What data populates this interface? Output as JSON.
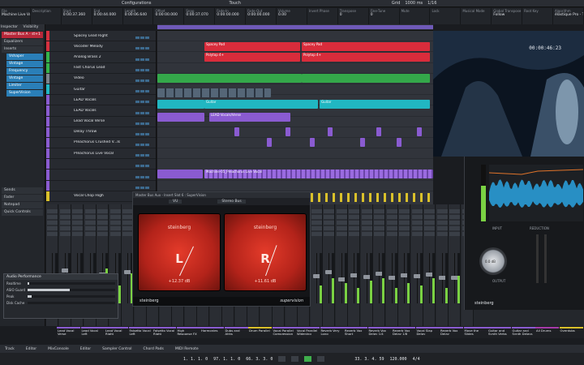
{
  "topbar": {
    "configurations": "Configurations",
    "automation_mode": "Touch",
    "grid": "Grid",
    "grid_value": "1000 ms",
    "quantize": "1/16"
  },
  "infobar": {
    "columns": [
      {
        "h": "File",
        "v": "Machine Live Vocal"
      },
      {
        "h": "Description",
        "v": ""
      },
      {
        "h": "Start",
        "v": "0:00:37.360"
      },
      {
        "h": "End",
        "v": "0:00:44.000"
      },
      {
        "h": "Length",
        "v": "0:00:06.640"
      },
      {
        "h": "Offset",
        "v": "0:00:00.000"
      },
      {
        "h": "Snap",
        "v": "0:00:37.070"
      },
      {
        "h": "Fade-In",
        "v": "0:00:00.000"
      },
      {
        "h": "Fade-Out",
        "v": "0:00:00.000"
      },
      {
        "h": "Volume",
        "v": "0.00"
      },
      {
        "h": "Invert Phase",
        "v": ""
      },
      {
        "h": "Transpose",
        "v": "0"
      },
      {
        "h": "Fine-Tune",
        "v": "0"
      },
      {
        "h": "Mute",
        "v": ""
      },
      {
        "h": "Lock",
        "v": ""
      },
      {
        "h": "Musical Mode",
        "v": ""
      },
      {
        "h": "Global Transpose",
        "v": "Follow"
      },
      {
        "h": "Root Key",
        "v": ""
      },
      {
        "h": "Algorithm",
        "v": "élastique Pro - Time"
      }
    ]
  },
  "inspector": {
    "tabs": [
      "Inspector",
      "Visibility"
    ],
    "selected_track": "Master Bus A - st+1",
    "sections": [
      "Equalizers",
      "Inserts"
    ],
    "inserts": [
      "Vshaper",
      "Vintage",
      "Frequency",
      "Vintage",
      "Limiter",
      "SuperVision"
    ],
    "lower_sections": [
      "Sends",
      "Fader",
      "Notepad",
      "Quick Controls"
    ]
  },
  "tracks": [
    {
      "name": "Spacey Lead Right",
      "color": "#d6303f"
    },
    {
      "name": "Vocoder Melody",
      "color": "#d6303f"
    },
    {
      "name": "Analog Brass 2",
      "color": "#34b34a"
    },
    {
      "name": "Fast Chorus Lead",
      "color": "#34b34a"
    },
    {
      "name": "Video",
      "color": "#7c838c"
    },
    {
      "name": "Guitar",
      "color": "#20b6c2"
    },
    {
      "name": "LEAD Vocals",
      "color": "#8a5bd1"
    },
    {
      "name": "LEAD Vocals",
      "color": "#8a5bd1"
    },
    {
      "name": "Lead Vocal Verse",
      "color": "#8a5bd1"
    },
    {
      "name": "Delay Throw",
      "color": "#8a5bd1"
    },
    {
      "name": "Preachorus Crushed V...Is",
      "color": "#8a5bd1"
    },
    {
      "name": "Preachorus Live Vocal",
      "color": "#8a5bd1"
    },
    {
      "name": "",
      "color": "#8a5bd1"
    },
    {
      "name": "",
      "color": "#8a5bd1"
    },
    {
      "name": "",
      "color": "#8a5bd1"
    },
    {
      "name": "Vocal Chop High",
      "color": "#d9c02a"
    }
  ],
  "events": {
    "spacey_a": "Spacey Pad",
    "spacey_b": "Spacey Pad",
    "poly_a": "Polytop 4+",
    "poly_b": "Polytop 4+",
    "guitar_a": "Guitar",
    "guitar_b": "Guitar",
    "lead_verse": "LEAD Vocals/Verse",
    "preachorus": "Machine-05_Preachorus Live Vocal"
  },
  "video": {
    "timecode": "00:00:46:23"
  },
  "supervision": {
    "window_title": "Master Bus Aux - Insert Slot 6 : SuperVision",
    "module": "VU",
    "channel": "Stereo Bus",
    "brand": "steinberg",
    "left": {
      "label": "L",
      "value": "+12.37 dB",
      "level": 0.78
    },
    "right": {
      "label": "R",
      "value": "+11.61 dB",
      "level": 0.72
    },
    "footer_brand": "steinberg",
    "product": "supervision"
  },
  "right_plugin": {
    "input_label": "INPUT",
    "reduction_label": "REDUCTION",
    "output_label": "OUTPUT",
    "knob_value": "0.0 dB",
    "brand": "steinberg"
  },
  "audio_performance": {
    "title": "Audio Performance",
    "rows": [
      {
        "label": "Realtime",
        "level": 0.02
      },
      {
        "label": "ASIO Guard",
        "level": 0.48
      },
      {
        "label": "Peak",
        "level": 0.05
      },
      {
        "label": "Disk Cache",
        "level": 0.0
      }
    ]
  },
  "mixer_names": [
    {
      "name": "Lead Vocal Verse",
      "color": "#8a5bd1"
    },
    {
      "name": "Lead Vocal Left",
      "color": "#8a5bd1"
    },
    {
      "name": "Lead Vocal Right",
      "color": "#8a5bd1"
    },
    {
      "name": "Falsetto Vocal Left",
      "color": "#8a5bd1"
    },
    {
      "name": "Falsetto Vocal Right",
      "color": "#8a5bd1"
    },
    {
      "name": "High Response FX Vocal",
      "color": "#8a5bd1"
    },
    {
      "name": "Harmonies",
      "color": "#8a5bd1"
    },
    {
      "name": "Dubs and Ahhs",
      "color": "#8a5bd1"
    },
    {
      "name": "Drum Parallel",
      "color": "#d9c02a"
    },
    {
      "name": "Vocal Parallel Compression",
      "color": "#8a5bd1"
    },
    {
      "name": "Vocal Parallel Widening",
      "color": "#8a5bd1"
    },
    {
      "name": "Reverb Very Long",
      "color": "#8a5bd1"
    },
    {
      "name": "Reverb Vox Short",
      "color": "#8a5bd1"
    },
    {
      "name": "Reverb Vox Delay 1/4",
      "color": "#8a5bd1"
    },
    {
      "name": "Reverb Vox Delay 1/8",
      "color": "#8a5bd1"
    },
    {
      "name": "Vocal Slap Delay",
      "color": "#8a5bd1"
    },
    {
      "name": "Reverb Vox Delay",
      "color": "#8a5bd1"
    },
    {
      "name": "Move the Slides",
      "color": "#8a5bd1"
    },
    {
      "name": "Guitar and Synth Verbs",
      "color": "#8a5bd1"
    },
    {
      "name": "Guitar and Synth Delays",
      "color": "#8a5bd1"
    },
    {
      "name": "All Drums",
      "color": "#a53aa8"
    },
    {
      "name": "Overdubs",
      "color": "#d9c02a"
    }
  ],
  "bottom_tabs": [
    "Track",
    "Editor",
    "MixConsole",
    "Editor",
    "Sampler Control",
    "Chord Pads",
    "MIDI Remote"
  ],
  "transport": {
    "left_locator": "1. 1. 1. 0",
    "right_locator": "97. 1. 1. 0",
    "position": "66. 3. 3. 0",
    "position_bars": "33. 3. 4. 59",
    "tempo": "120.000",
    "signature": "4/4"
  }
}
